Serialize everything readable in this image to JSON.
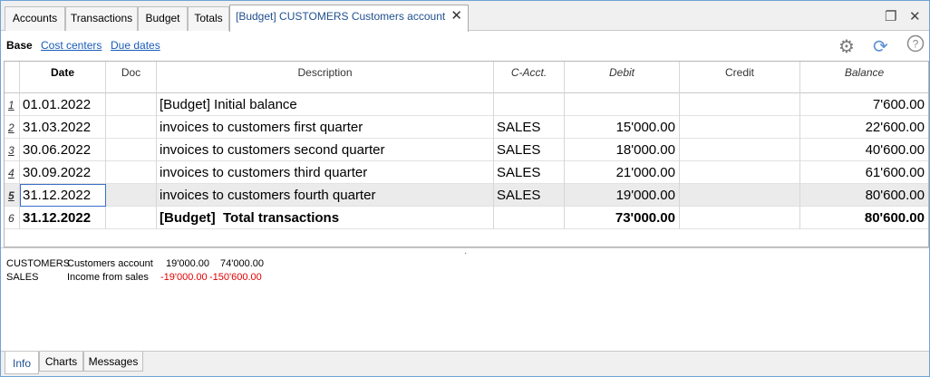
{
  "tabs": [
    {
      "label": "Accounts"
    },
    {
      "label": "Transactions"
    },
    {
      "label": "Budget"
    },
    {
      "label": "Totals"
    },
    {
      "label": "[Budget] CUSTOMERS Customers account",
      "close": "✕"
    }
  ],
  "window_controls": {
    "restore": "❐",
    "close": "✕"
  },
  "subnav": {
    "base": "Base",
    "cost_centers": "Cost centers",
    "due_dates": "Due dates"
  },
  "toolbar_icons": [
    "gear-icon",
    "refresh-icon",
    "help-icon"
  ],
  "table": {
    "headers": {
      "date": "Date",
      "doc": "Doc",
      "description": "Description",
      "cacct": "C-Acct.",
      "debit": "Debit",
      "credit": "Credit",
      "balance": "Balance"
    },
    "rows": [
      {
        "n": "1",
        "date": "01.01.2022",
        "doc": "",
        "desc": "[Budget] Initial balance",
        "cacct": "",
        "debit": "",
        "credit": "",
        "balance": "7'600.00"
      },
      {
        "n": "2",
        "date": "31.03.2022",
        "doc": "",
        "desc": "invoices to customers first quarter",
        "cacct": "SALES",
        "debit": "15'000.00",
        "credit": "",
        "balance": "22'600.00"
      },
      {
        "n": "3",
        "date": "30.06.2022",
        "doc": "",
        "desc": "invoices to customers second quarter",
        "cacct": "SALES",
        "debit": "18'000.00",
        "credit": "",
        "balance": "40'600.00"
      },
      {
        "n": "4",
        "date": "30.09.2022",
        "doc": "",
        "desc": "invoices to customers third quarter",
        "cacct": "SALES",
        "debit": "21'000.00",
        "credit": "",
        "balance": "61'600.00"
      },
      {
        "n": "5",
        "date": "31.12.2022",
        "doc": "",
        "desc": "invoices to customers fourth quarter",
        "cacct": "SALES",
        "debit": "19'000.00",
        "credit": "",
        "balance": "80'600.00"
      },
      {
        "n": "6",
        "date": "31.12.2022",
        "doc": "",
        "desc": "[Budget]  Total transactions",
        "cacct": "",
        "debit": "73'000.00",
        "credit": "",
        "balance": "80'600.00"
      }
    ]
  },
  "info": [
    {
      "account": "CUSTOMERS",
      "description": "Customers account",
      "amount1": "19'000.00",
      "amount2": "74'000.00"
    },
    {
      "account": "SALES",
      "description": "Income from sales",
      "amount1": "-19'000.00",
      "amount2": "-150'600.00"
    }
  ],
  "bottom_tabs": [
    {
      "label": "Info"
    },
    {
      "label": "Charts"
    },
    {
      "label": "Messages"
    }
  ],
  "colors": {
    "link": "#1a5bb8",
    "negative": "#e00000",
    "active_tab_text": "#1f4f8f"
  }
}
